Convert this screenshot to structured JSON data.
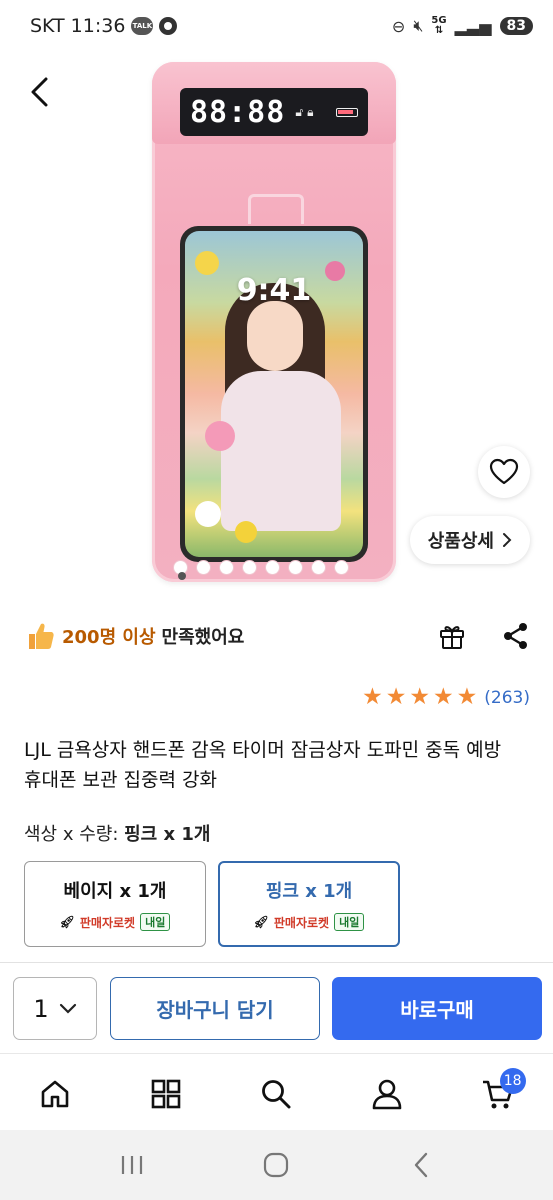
{
  "status_bar": {
    "carrier": "SKT",
    "time": "11:36",
    "talk_label": "TALK",
    "network": "5G",
    "battery": "83"
  },
  "hero": {
    "display_time": "88:88",
    "phone_time": "9:41",
    "detail_button_label": "상품상세"
  },
  "satisfaction": {
    "count_label": "200명 이상",
    "text": "만족했어요"
  },
  "rating": {
    "stars": 5,
    "review_count": "(263)"
  },
  "product": {
    "title": "LJL 금욕상자 핸드폰 감옥 타이머 잠금상자 도파민 중독 예방 휴대폰 보관 집중력 강화",
    "option_label_prefix": "색상 x 수량: ",
    "option_label_value": "핑크 x 1개"
  },
  "options": [
    {
      "name": "베이지 x 1개",
      "rocket": "판매자로켓",
      "delivery": "내일",
      "selected": false
    },
    {
      "name": "핑크 x 1개",
      "rocket": "판매자로켓",
      "delivery": "내일",
      "selected": true
    }
  ],
  "purchase_bar": {
    "quantity": "1",
    "cart_label": "장바구니 담기",
    "buy_label": "바로구매"
  },
  "bottom_nav": {
    "items": [
      "home-icon",
      "category-icon",
      "search-icon",
      "user-icon",
      "cart-icon"
    ],
    "cart_badge": "18"
  },
  "colors": {
    "accent_blue": "#346aef",
    "outline_blue": "#346aae",
    "star_orange": "#f28a35",
    "satisfaction_orange": "#b85a00"
  }
}
